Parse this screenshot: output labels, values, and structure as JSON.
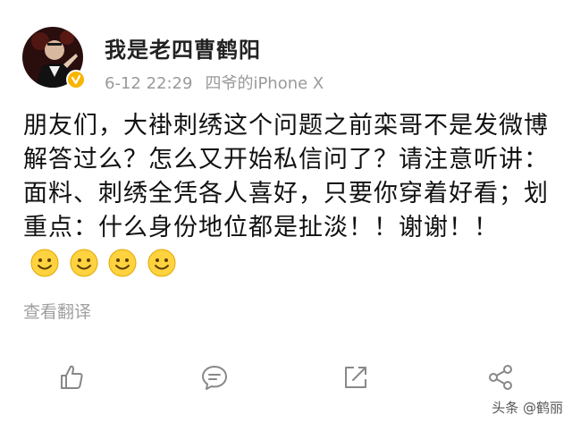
{
  "post": {
    "username": "我是老四曹鹤阳",
    "timestamp": "6-12 22:29",
    "source": "四爷的iPhone X",
    "paragraph": "朋友们，大褂刺绣这个问题之前栾哥不是发微博解答过么？怎么又开始私信问了？请注意听讲：面料、刺绣全凭各人喜好，只要你穿着好看；划重点：什么身份地位都是扯淡！！谢谢！！",
    "emojis": [
      "smile-emoji",
      "smile-emoji",
      "smile-emoji",
      "smile-emoji"
    ],
    "translate_label": "查看翻译"
  },
  "actions": [
    "like-icon",
    "comment-icon",
    "repost-icon",
    "share-icon"
  ],
  "watermark": "头条 @鹤丽",
  "colors": {
    "verified_badge": "#f7b500",
    "meta_text": "#9a9a9a",
    "icon_stroke": "#888888"
  }
}
